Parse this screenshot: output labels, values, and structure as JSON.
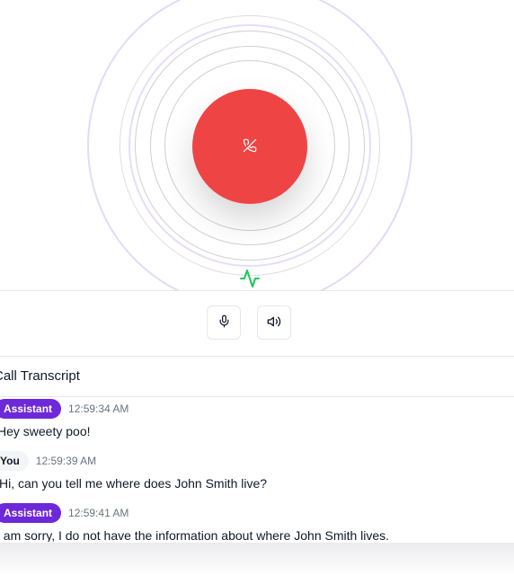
{
  "call": {
    "end_call_icon": "phone-off-icon",
    "activity_icon": "activity-icon",
    "accent_color": "#ef4444",
    "ring_color": "#e4d9f7",
    "activity_color": "#22c55e"
  },
  "controls": [
    {
      "name": "mic-button",
      "icon": "mic-icon"
    },
    {
      "name": "speaker-button",
      "icon": "volume-icon"
    }
  ],
  "transcript": {
    "title": "Call Transcript",
    "messages": [
      {
        "role": "Assistant",
        "time": "12:59:34 AM",
        "text": "Hey sweety poo!"
      },
      {
        "role": "You",
        "time": "12:59:39 AM",
        "text": "Hi, can you tell me where does John Smith live?"
      },
      {
        "role": "Assistant",
        "time": "12:59:41 AM",
        "text": "I am sorry, I do not have the information about where John Smith lives."
      }
    ]
  },
  "colors": {
    "assistant_badge": "#6d28d9",
    "you_badge": "#f3f4f6",
    "time_text": "#6b7280"
  }
}
